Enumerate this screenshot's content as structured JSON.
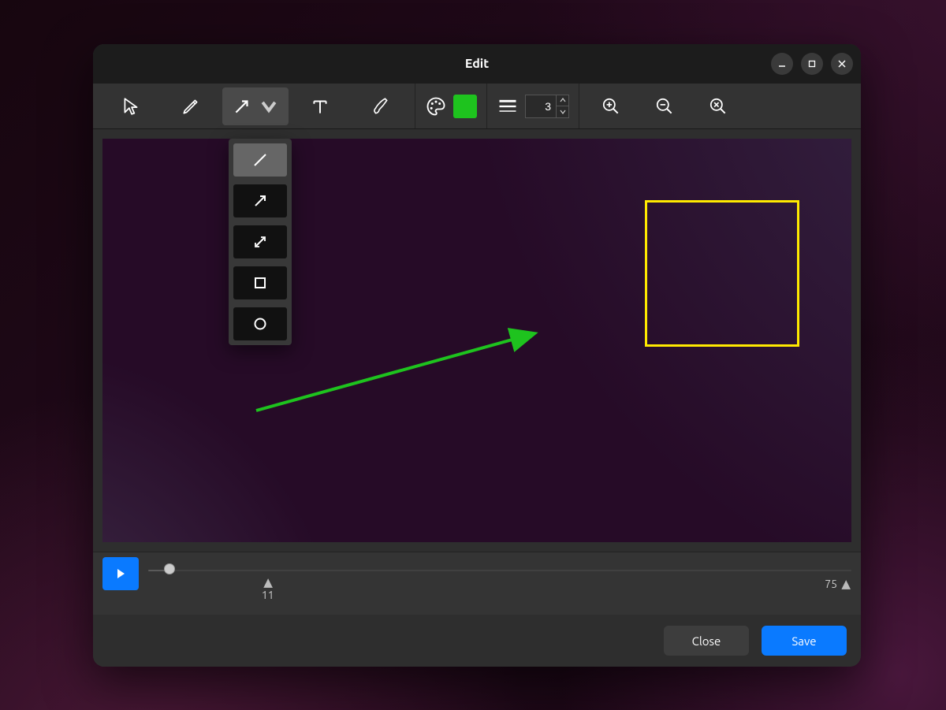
{
  "window": {
    "title": "Edit"
  },
  "toolbar": {
    "stroke_width": "3",
    "color_swatch": "#1ec31e"
  },
  "dropdown": {
    "items": [
      "line",
      "arrow",
      "double-arrow",
      "rectangle",
      "circle"
    ],
    "selected_index": 0
  },
  "annotations": {
    "arrow": {
      "color": "#1ec31e"
    },
    "rect": {
      "color": "#ffea00"
    }
  },
  "timeline": {
    "playhead_pct": 3,
    "marker_start_pct": 17,
    "marker_start_label": "11",
    "marker_end_label": "75"
  },
  "footer": {
    "close_label": "Close",
    "save_label": "Save"
  }
}
